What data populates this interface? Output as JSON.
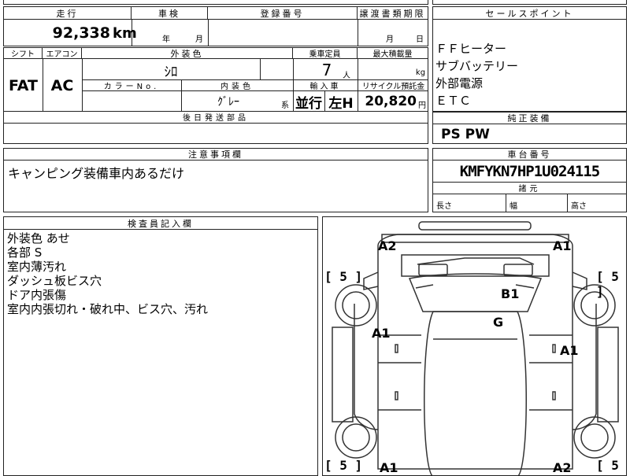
{
  "top": {
    "mileage_header": "走行",
    "mileage_value": "92,338",
    "mileage_unit": "km",
    "inspection_header": "車検",
    "inspection_year": "年",
    "inspection_month": "月",
    "reg_header": "登録番号",
    "transfer_header": "譲渡書類期限",
    "transfer_month": "月",
    "transfer_day": "日"
  },
  "spec": {
    "shift_header": "シフト",
    "shift_value": "FAT",
    "ac_header": "エアコン",
    "ac_value": "AC",
    "exterior_header": "外装色",
    "exterior_value": "ｼﾛ",
    "capacity_header": "乗車定員",
    "capacity_value": "7",
    "capacity_unit": "人",
    "maxload_header": "最大積載量",
    "maxload_unit": "kg",
    "color_no_header": "カラーNo.",
    "interior_header": "内装色",
    "interior_value": "ｸﾞﾚｰ",
    "interior_suffix": "系",
    "import_header": "輸入車",
    "import_type": "並行",
    "steering": "左H",
    "recycle_header": "リサイクル預託金",
    "recycle_value": "20,820",
    "recycle_unit": "円",
    "later_parts_header": "後日発送部品"
  },
  "sales": {
    "header": "セールスポイント",
    "items": [
      "ＦＦヒーター",
      "サブバッテリー",
      "外部電源",
      "ＥＴＣ"
    ]
  },
  "equipment": {
    "header": "純正装備",
    "value": "PS PW"
  },
  "notes": {
    "header": "注意事項欄",
    "text": "キャンピング装備車内あるだけ"
  },
  "chassis": {
    "header": "車台番号",
    "value": "KMFYKN7HP1U024115",
    "dims_header": "諸元",
    "length_label": "長さ",
    "width_label": "幅",
    "height_label": "高さ"
  },
  "inspector": {
    "header": "検査員記入欄",
    "lines": [
      "外装色 あせ",
      "各部 S",
      "室内薄汚れ",
      "ダッシュ板ビス穴",
      "ドア内張傷",
      "室内内張切れ・破れ中、ビス穴、汚れ"
    ]
  },
  "diagram": {
    "tire_fl": "[ 5 ]",
    "tire_fr": "[ 5 ]",
    "tire_rl": "[ 5 ]",
    "tire_rr": "[ 5 ]",
    "mark_a2_front": "A2",
    "mark_a1_front": "A1",
    "mark_b1": "B1",
    "mark_g": "G",
    "mark_a1_left": "A1",
    "mark_a1_right": "A1",
    "mark_a1_rear": "A1",
    "mark_a2_rear": "A2"
  }
}
